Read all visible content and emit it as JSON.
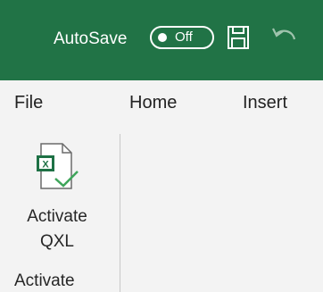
{
  "titlebar": {
    "autosave_label": "AutoSave",
    "autosave_state": "Off",
    "save_icon": "save-icon",
    "undo_icon": "undo-icon",
    "background_color": "#217346"
  },
  "menu": {
    "tabs": [
      {
        "label": "File"
      },
      {
        "label": "Home"
      },
      {
        "label": "Insert"
      }
    ]
  },
  "ribbon": {
    "addin_button": {
      "label_line1": "Activate",
      "label_line2": "QXL",
      "icon": "excel-check-icon"
    },
    "group_label": "Activate"
  }
}
